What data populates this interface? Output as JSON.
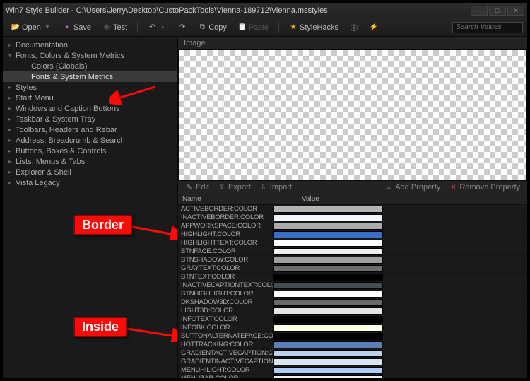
{
  "title": "Win7 Style Builder - C:\\Users\\Jerry\\Desktop\\CustoPackTools\\Vienna-189712\\Vienna.msstyles",
  "toolbar": {
    "open": "Open",
    "save": "Save",
    "test": "Test",
    "copy": "Copy",
    "paste": "Paste",
    "stylehacks": "StyleHacks",
    "search_placeholder": "Search Values"
  },
  "tree": [
    {
      "label": "Documentation",
      "exp": false,
      "level": 0
    },
    {
      "label": "Fonts, Colors & System Metrics",
      "exp": true,
      "level": 0
    },
    {
      "label": "Colors (Globals)",
      "level": 1
    },
    {
      "label": "Fonts & System Metrics",
      "level": 1,
      "sel": true
    },
    {
      "label": "Styles",
      "exp": false,
      "level": 0
    },
    {
      "label": "Start Menu",
      "exp": false,
      "level": 0
    },
    {
      "label": "Windows and Caption Buttons",
      "exp": false,
      "level": 0
    },
    {
      "label": "Taskbar & System Tray",
      "exp": false,
      "level": 0
    },
    {
      "label": "Toolbars, Headers and Rebar",
      "exp": false,
      "level": 0
    },
    {
      "label": "Address, Breadcrumb & Search",
      "exp": false,
      "level": 0
    },
    {
      "label": "Buttons, Boxes & Controls",
      "exp": false,
      "level": 0
    },
    {
      "label": "Lists, Menus & Tabs",
      "exp": false,
      "level": 0
    },
    {
      "label": "Explorer & Shell",
      "exp": false,
      "level": 0
    },
    {
      "label": "Vista Legacy",
      "exp": false,
      "level": 0
    }
  ],
  "image_hdr": "Image",
  "propbar": {
    "edit": "Edit",
    "export": "Export",
    "import": "Import",
    "add": "Add Property",
    "remove": "Remove Property"
  },
  "grid": {
    "col_name": "Name",
    "col_value": "Value",
    "rows": [
      {
        "name": "ACTIVEBORDER:COLOR",
        "color": "#b5b5b5"
      },
      {
        "name": "INACTIVEBORDER:COLOR",
        "color": "#f4f7fc"
      },
      {
        "name": "APPWORKSPACE:COLOR",
        "color": "#ababab"
      },
      {
        "name": "HIGHLIGHT:COLOR",
        "color": "#3a6ecb"
      },
      {
        "name": "HIGHLIGHTTEXT:COLOR",
        "color": "#ffffff"
      },
      {
        "name": "BTNFACE:COLOR",
        "color": "#f0f0f0"
      },
      {
        "name": "BTNSHADOW:COLOR",
        "color": "#a0a0a0"
      },
      {
        "name": "GRAYTEXT:COLOR",
        "color": "#6d6d6d"
      },
      {
        "name": "BTNTEXT:COLOR",
        "color": "#000000"
      },
      {
        "name": "INACTIVECAPTIONTEXT:COLOR",
        "color": "#434e54"
      },
      {
        "name": "BTNHIGHLIGHT:COLOR",
        "color": "#ffffff"
      },
      {
        "name": "DKSHADOW3D:COLOR",
        "color": "#696969"
      },
      {
        "name": "LIGHT3D:COLOR",
        "color": "#e3e3e3"
      },
      {
        "name": "INFOTEXT:COLOR",
        "color": "#000000"
      },
      {
        "name": "INFOBK:COLOR",
        "color": "#ffffe1"
      },
      {
        "name": "BUTTONALTERNATEFACE:COLOR",
        "color": "#000000"
      },
      {
        "name": "HOTTRACKING:COLOR",
        "color": "#5b7fb8"
      },
      {
        "name": "GRADIENTACTIVECAPTION:COLOR",
        "color": "#b9d1ea"
      },
      {
        "name": "GRADIENTINACTIVECAPTION:COLOR",
        "color": "#d7e4f2"
      },
      {
        "name": "MENUHILIGHT:COLOR",
        "color": "#adccf7"
      },
      {
        "name": "MENUBAR:COLOR",
        "color": "#f0f0f0"
      }
    ]
  },
  "annotations": {
    "border": "Border",
    "inside": "Inside"
  }
}
